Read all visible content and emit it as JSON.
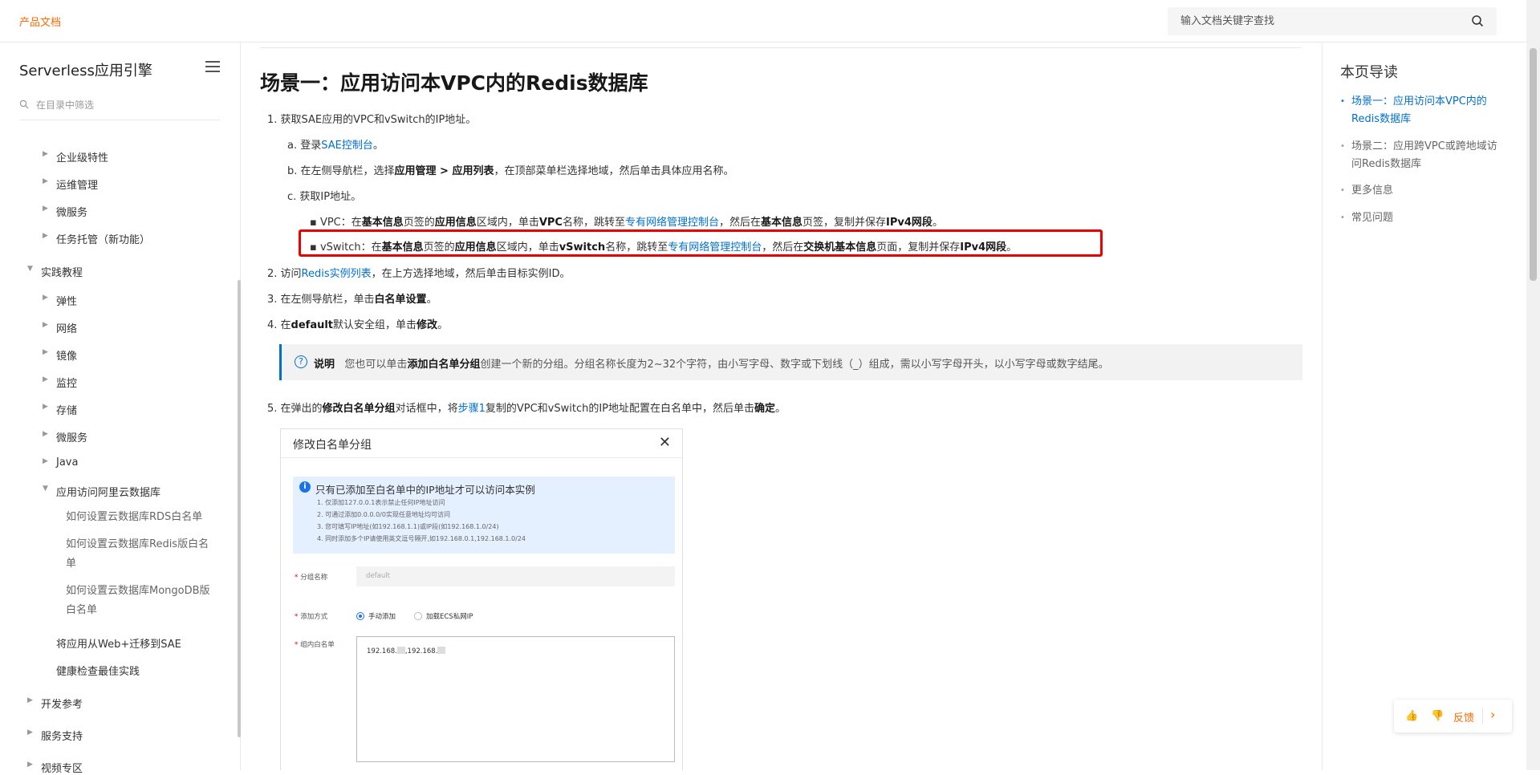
{
  "header": {
    "brand": "产品文档",
    "search_placeholder": "输入文档关键字查找"
  },
  "sidebar": {
    "title": "Serverless应用引擎",
    "filter_placeholder": "在目录中筛选",
    "items": [
      "企业级特性",
      "运维管理",
      "微服务",
      "任务托管（新功能）",
      "实践教程",
      "弹性",
      "网络",
      "镜像",
      "监控",
      "存储",
      "微服务",
      "Java",
      "应用访问阿里云数据库",
      "如何设置云数据库RDS白名单",
      "如何设置云数据库Redis版白名单",
      "如何设置云数据库MongoDB版白名单",
      "将应用从Web+迁移到SAE",
      "健康检查最佳实践",
      "开发参考",
      "服务支持",
      "视频专区"
    ]
  },
  "content": {
    "heading": "场景一：应用访问本VPC内的Redis数据库",
    "step1": "1. 获取SAE应用的VPC和vSwitch的IP地址。",
    "step1a_pre": "a. 登录",
    "step1a_link": "SAE控制台",
    "step1a_post": "。",
    "step1b_pre": "b. 在左侧导航栏，选择",
    "step1b_bold1": "应用管理 > 应用列表",
    "step1b_post": "，在顶部菜单栏选择地域，然后单击具体应用名称。",
    "step1c": "c. 获取IP地址。",
    "vpc": {
      "t1": "VPC：在",
      "b1": "基本信息",
      "t2": "页签的",
      "b2": "应用信息",
      "t3": "区域内，单击",
      "b3": "VPC",
      "t4": "名称，跳转至",
      "link": "专有网络管理控制台",
      "t5": "，然后在",
      "b4": "基本信息",
      "t6": "页签，复制并保存",
      "b5": "IPv4网段",
      "t7": "。"
    },
    "vswitch": {
      "t1": "vSwitch：在",
      "b1": "基本信息",
      "t2": "页签的",
      "b2": "应用信息",
      "t3": "区域内，单击",
      "b3": "vSwitch",
      "t4": "名称，跳转至",
      "link": "专有网络管理控制台",
      "t5": "，然后在",
      "b4": "交换机基本信息",
      "t6": "页面，复制并保存",
      "b5": "IPv4网段",
      "t7": "。"
    },
    "step2_pre": "2. 访问",
    "step2_link": "Redis实例列表",
    "step2_post": "，在上方选择地域，然后单击目标实例ID。",
    "step3_pre": "3. 在左侧导航栏，单击",
    "step3_bold": "白名单设置",
    "step3_post": "。",
    "step4_pre": "4. 在",
    "step4_bold1": "default",
    "step4_mid": "默认安全组，单击",
    "step4_bold2": "修改",
    "step4_post": "。",
    "note_label": "说明",
    "note_pre": "您也可以单击",
    "note_bold": "添加白名单分组",
    "note_post": "创建一个新的分组。分组名称长度为2~32个字符，由小写字母、数字或下划线（_）组成，需以小写字母开头，以小写字母或数字结尾。",
    "step5_pre": "5. 在弹出的",
    "step5_bold1": "修改白名单分组",
    "step5_mid1": "对话框中，将",
    "step5_link": "步骤1",
    "step5_mid2": "复制的VPC和vSwitch的IP地址配置在白名单中，然后单击",
    "step5_bold2": "确定",
    "step5_post": "。"
  },
  "dialog": {
    "title": "修改白名单分组",
    "info_head": "只有已添加至白名单中的IP地址才可以访问本实例",
    "info_lines": [
      "1. 仅添加127.0.0.1表示禁止任何IP地址访问",
      "2. 可通过添加0.0.0.0/0实现任意地址均可访问",
      "3. 您可填写IP地址(如192.168.1.1)或IP段(如192.168.1.0/24)",
      "4. 同时添加多个IP请使用英文逗号隔开,如192.168.0.1,192.168.1.0/24"
    ],
    "group_label": "分组名称",
    "group_value": "default",
    "method_label": "添加方式",
    "method_manual": "手动添加",
    "method_ecs": "加载ECS私网IP",
    "whitelist_label": "组内白名单",
    "whitelist_prefix1": "192.168.",
    "whitelist_sep": ",192.168."
  },
  "toc": {
    "title": "本页导读",
    "items": [
      "场景一：应用访问本VPC内的Redis数据库",
      "场景二：应用跨VPC或跨地域访问Redis数据库",
      "更多信息",
      "常见问题"
    ]
  },
  "feedback": {
    "label": "反馈"
  }
}
